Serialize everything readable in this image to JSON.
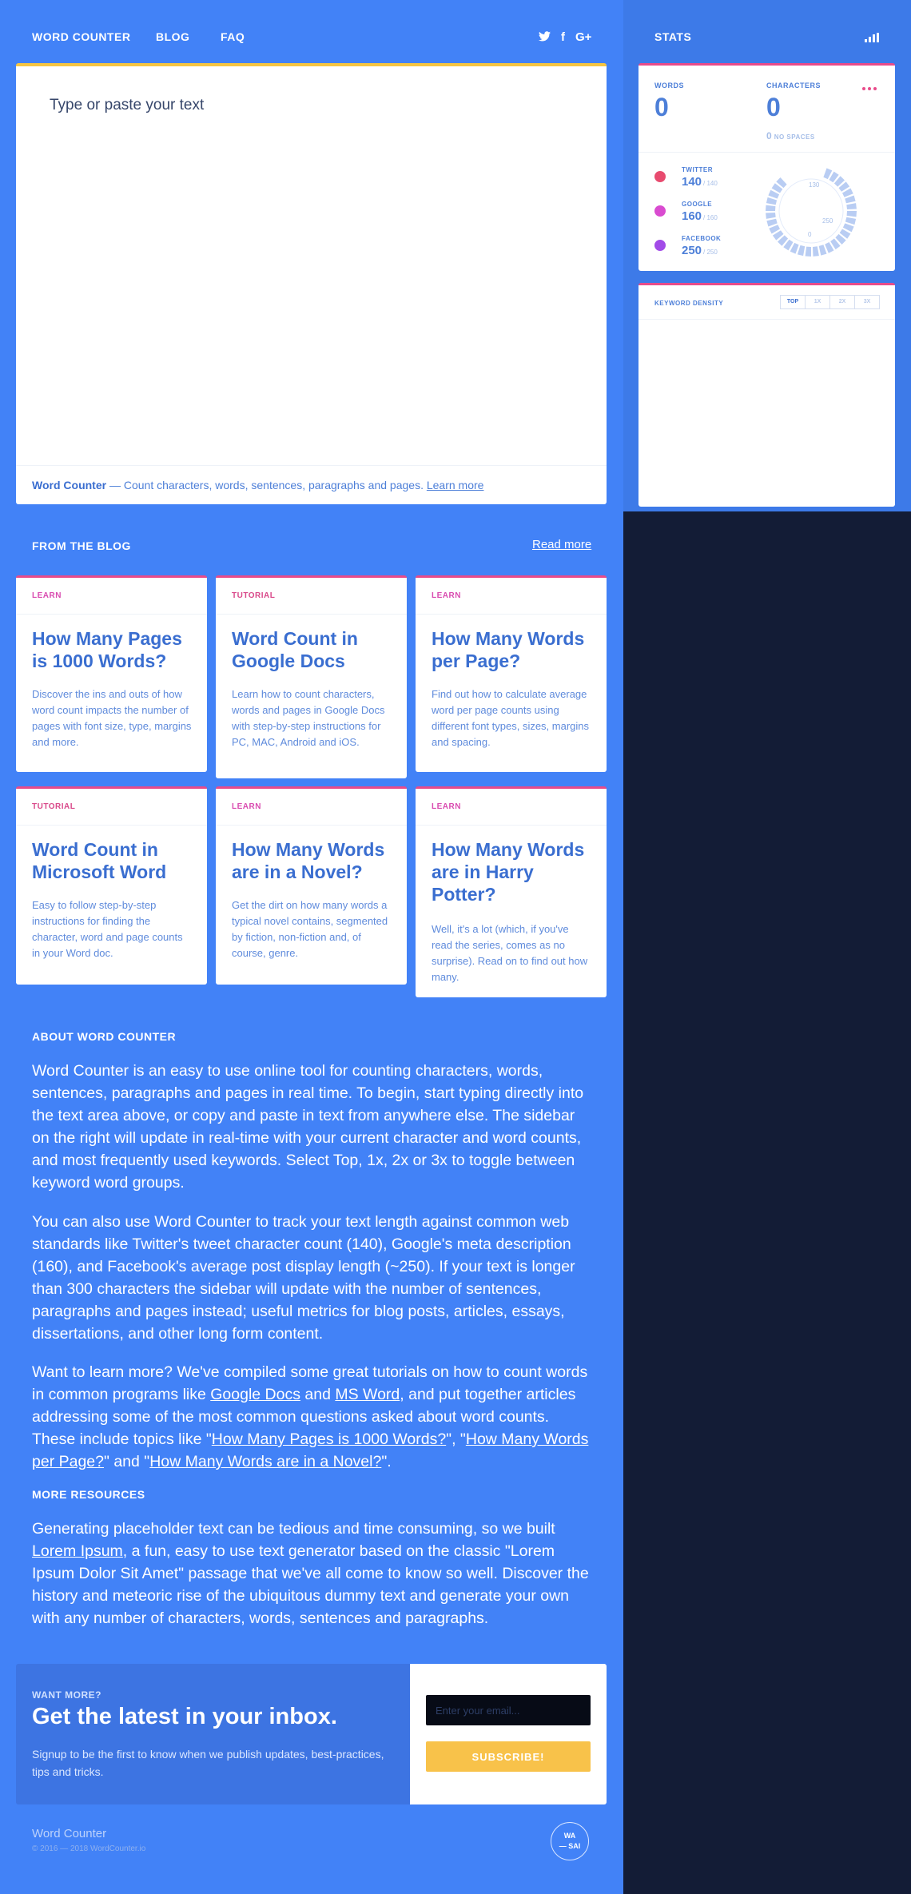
{
  "nav": {
    "links": [
      "WORD COUNTER",
      "BLOG",
      "FAQ"
    ],
    "social": {
      "twitter": "twitter-icon",
      "facebook": "facebook-icon",
      "google": "google-plus-icon"
    }
  },
  "editor": {
    "placeholder": "Type or paste your text",
    "footer_brand": "Word Counter",
    "footer_text": " — Count characters, words, sentences, paragraphs and pages. ",
    "footer_link": "Learn more"
  },
  "stats": {
    "title": "STATS",
    "words_label": "WORDS",
    "words_value": "0",
    "chars_label": "CHARACTERS",
    "chars_value": "0",
    "no_spaces_value": "0",
    "no_spaces_label": "NO SPACES",
    "social": [
      {
        "name": "TWITTER",
        "value": "140",
        "limit": "/ 140",
        "color": "#e84b6f"
      },
      {
        "name": "GOOGLE",
        "value": "160",
        "limit": "/ 160",
        "color": "#d94bd0"
      },
      {
        "name": "FACEBOOK",
        "value": "250",
        "limit": "/ 250",
        "color": "#a24be8"
      }
    ],
    "gauge_labels": [
      "130",
      "250",
      "0"
    ]
  },
  "keyword_density": {
    "title": "KEYWORD DENSITY",
    "tabs": [
      "TOP",
      "1X",
      "2X",
      "3X"
    ],
    "active_tab": "TOP"
  },
  "blog": {
    "title": "FROM THE BLOG",
    "read_more": "Read more",
    "posts": [
      {
        "category": "LEARN",
        "cat_color": "#d94bb0",
        "title": "How Many Pages is 1000 Words?",
        "desc": "Discover the ins and outs of how word count impacts the number of pages with font size, type, margins and more."
      },
      {
        "category": "TUTORIAL",
        "cat_color": "#d9498a",
        "title": "Word Count in Google Docs",
        "desc": "Learn how to count characters, words and pages in Google Docs with step-by-step instructions for PC, MAC, Android and iOS."
      },
      {
        "category": "LEARN",
        "cat_color": "#d94bb0",
        "title": "How Many Words per Page?",
        "desc": "Find out how to calculate average word per page counts using different font types, sizes, margins and spacing."
      },
      {
        "category": "TUTORIAL",
        "cat_color": "#d9498a",
        "title": "Word Count in Microsoft Word",
        "desc": "Easy to follow step-by-step instructions for finding the character, word and page counts in your Word doc."
      },
      {
        "category": "LEARN",
        "cat_color": "#d94bb0",
        "title": "How Many Words are in a Novel?",
        "desc": "Get the dirt on how many words a typical novel contains, segmented by fiction, non-fiction and, of course, genre."
      },
      {
        "category": "LEARN",
        "cat_color": "#d94bb0",
        "title": "How Many Words are in Harry Potter?",
        "desc": "Well, it's a lot (which, if you've read the series, comes as no surprise). Read on to find out how many."
      }
    ]
  },
  "about": {
    "heading": "ABOUT WORD COUNTER",
    "p1": "Word Counter is an easy to use online tool for counting characters, words, sentences, paragraphs and pages in real time. To begin, start typing directly into the text area above, or copy and paste in text from anywhere else. The sidebar on the right will update in real-time with your current character and word counts, and most frequently used keywords. Select Top, 1x, 2x or 3x to toggle between keyword word groups.",
    "p2": "You can also use Word Counter to track your text length against common web standards like Twitter's tweet character count (140), Google's meta description (160), and Facebook's average post display length (~250). If your text is longer than 300 characters the sidebar will update with the number of sentences, paragraphs and pages instead; useful metrics for blog posts, articles, essays, dissertations, and other long form content.",
    "p3": {
      "t1": "Want to learn more? We've compiled some great tutorials on how to count words in common programs like ",
      "l1": "Google Docs",
      "t2": " and ",
      "l2": "MS Word",
      "t3": ", and put together articles addressing some of the most common questions asked about word counts. These include topics like \"",
      "l3": "How Many Pages is 1000 Words?",
      "t4": "\", \"",
      "l4": "How Many Words per Page?",
      "t5": "\" and \"",
      "l5": "How Many Words are in a Novel?",
      "t6": "\"."
    }
  },
  "resources": {
    "heading": "MORE RESOURCES",
    "t1": "Generating placeholder text can be tedious and time consuming, so we built ",
    "link": "Lorem Ipsum",
    "t2": ", a fun, easy to use text generator based on the classic \"Lorem Ipsum Dolor Sit Amet\" passage that we've all come to know so well. Discover the history and meteoric rise of the ubiquitous dummy text and generate your own with any number of characters, words, sentences and paragraphs."
  },
  "newsletter": {
    "kicker": "WANT MORE?",
    "title": "Get the latest in your inbox.",
    "desc": "Signup to be the first to know when we publish updates, best-practices, tips and tricks.",
    "email_placeholder": "Enter your email...",
    "button": "SUBSCRIBE!"
  },
  "footer": {
    "name": "Word Counter",
    "copyright": "© 2016 — 2018 WordCounter.io",
    "badge_line1": "WA",
    "badge_line2": "— SAI"
  },
  "colors": {
    "main_bg": "#4282f7",
    "dark_bg": "#131c36",
    "accent_pink": "#e84b8a",
    "accent_yellow": "#f6c542"
  }
}
